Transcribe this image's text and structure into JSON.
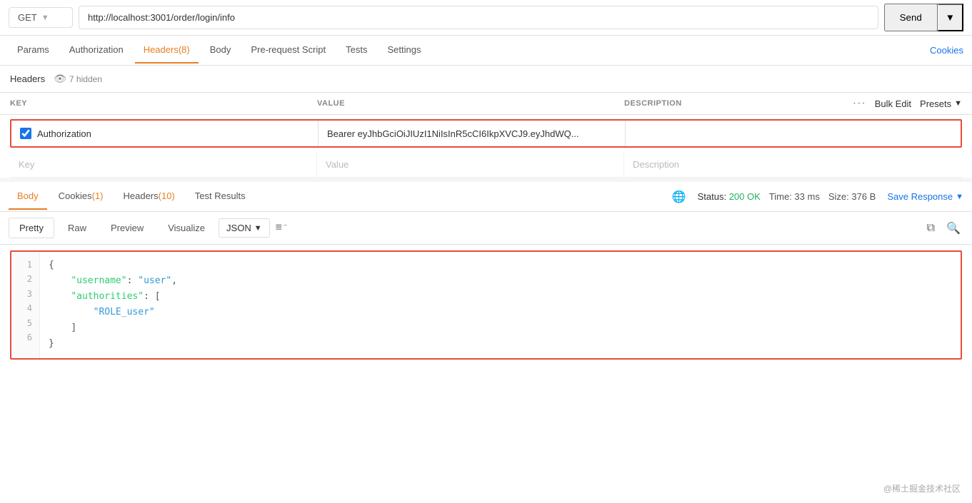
{
  "urlBar": {
    "method": "GET",
    "url": "http://localhost:3001/order/login/info",
    "sendLabel": "Send"
  },
  "requestTabs": {
    "tabs": [
      {
        "id": "params",
        "label": "Params",
        "count": null,
        "active": false
      },
      {
        "id": "authorization",
        "label": "Authorization",
        "count": null,
        "active": false
      },
      {
        "id": "headers",
        "label": "Headers",
        "count": "(8)",
        "active": true
      },
      {
        "id": "body",
        "label": "Body",
        "count": null,
        "active": false
      },
      {
        "id": "prerequest",
        "label": "Pre-request Script",
        "count": null,
        "active": false
      },
      {
        "id": "tests",
        "label": "Tests",
        "count": null,
        "active": false
      },
      {
        "id": "settings",
        "label": "Settings",
        "count": null,
        "active": false
      }
    ],
    "cookiesLabel": "Cookies"
  },
  "headersSubbar": {
    "title": "Headers",
    "hiddenCount": "7 hidden"
  },
  "headersTable": {
    "columns": {
      "key": "KEY",
      "value": "VALUE",
      "description": "DESCRIPTION"
    },
    "bulkEdit": "Bulk Edit",
    "presets": "Presets",
    "rows": [
      {
        "checked": true,
        "key": "Authorization",
        "value": "Bearer eyJhbGciOiJIUzI1NiIsInR5cCI6IkpXVCJ9.eyJhdWQ...",
        "description": ""
      }
    ],
    "emptyRow": {
      "key": "Key",
      "value": "Value",
      "description": "Description"
    }
  },
  "responseTabs": {
    "tabs": [
      {
        "id": "body",
        "label": "Body",
        "count": null,
        "active": true
      },
      {
        "id": "cookies",
        "label": "Cookies",
        "count": "(1)",
        "active": false
      },
      {
        "id": "headers",
        "label": "Headers",
        "count": "(10)",
        "active": false
      },
      {
        "id": "testresults",
        "label": "Test Results",
        "count": null,
        "active": false
      }
    ],
    "status": "200 OK",
    "time": "33 ms",
    "size": "376 B",
    "saveResponse": "Save Response"
  },
  "formatBar": {
    "tabs": [
      "Pretty",
      "Raw",
      "Preview",
      "Visualize"
    ],
    "activeTab": "Pretty",
    "format": "JSON"
  },
  "jsonContent": {
    "lines": [
      {
        "num": "1",
        "content": "{",
        "type": "brace"
      },
      {
        "num": "2",
        "content": "    \"username\": \"user\",",
        "type": "keyval"
      },
      {
        "num": "3",
        "content": "    \"authorities\": [",
        "type": "keyarr"
      },
      {
        "num": "4",
        "content": "        \"ROLE_user\"",
        "type": "arrval"
      },
      {
        "num": "5",
        "content": "    ]",
        "type": "bracket"
      },
      {
        "num": "6",
        "content": "}",
        "type": "brace"
      }
    ]
  },
  "watermark": "@稀土掘金技术社区"
}
